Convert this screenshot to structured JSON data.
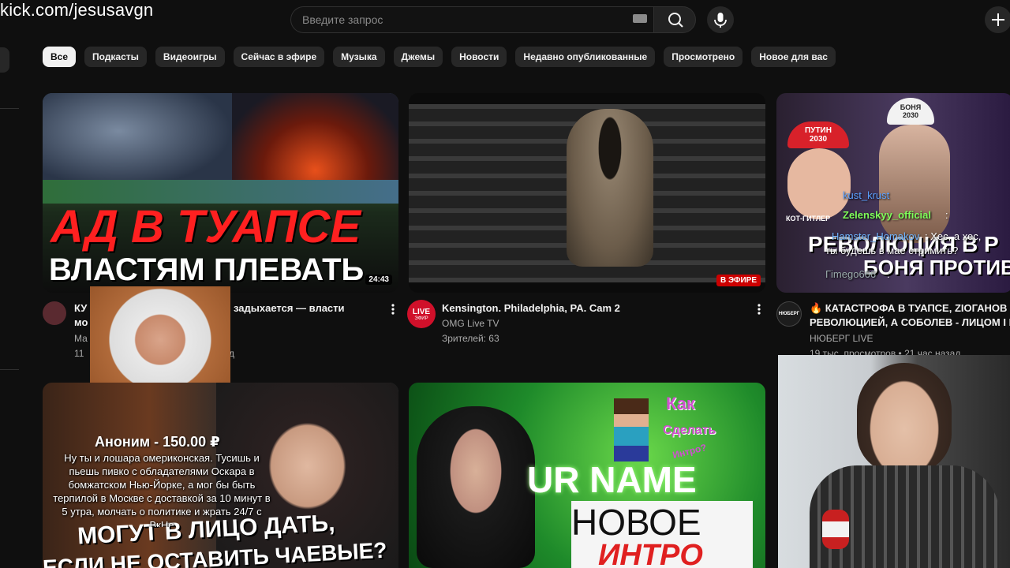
{
  "overlay": {
    "url": "kick.com/jesusavgn"
  },
  "search": {
    "placeholder": "Введите запрос"
  },
  "chips": [
    "Все",
    "Подкасты",
    "Видеоигры",
    "Сейчас в эфире",
    "Музыка",
    "Джемы",
    "Новости",
    "Недавно опубликованные",
    "Просмотрено",
    "Новое для вас"
  ],
  "videos": [
    {
      "thumb_top": "АД В ТУАПСЕ",
      "thumb_bottom": "ВЛАСТЯМ ПЛЕВАТЬ",
      "duration": "24:43",
      "title_visible_a": "КУ",
      "title_visible_b": "задыхается — власти",
      "title_visible_c": "мо",
      "channel_visible": "Ма",
      "stats_visible_a": "11",
      "stats_visible_b": "д"
    },
    {
      "title": "Kensington. Philadelphia, PA. Cam 2",
      "channel": "OMG Live TV",
      "stats": "Зрителей: 63",
      "live_badge": "В ЭФИРЕ",
      "avatar_text": "LIVE",
      "avatar_sub": "ЭФИР"
    },
    {
      "title_line1": "🔥 КАТАСТРОФА В ТУАПСЕ, ZIОГАНОВ П",
      "title_line2": "РЕВОЛЮЦИЕЙ, А СОБОЛЕВ - ЛИЦОМ І М",
      "channel": "НЮБЕРГ LIVE",
      "stats": "19 тыс. просмотров • 21 час назад",
      "avatar_text": "НЮБЕРГ",
      "thumb_text1": "РЕВОЛЮЦИЯ В Р",
      "thumb_text2": "БОНЯ ПРОТИВ Б",
      "cap1": "ПУТИН 2030",
      "cap2": "БОНЯ 2030",
      "label": "КОТ-ГИТЛЕР"
    },
    {
      "thumb_text1": "МОГУТ В ЛИЦО ДАТЬ,",
      "thumb_text2": "ЕСЛИ НЕ ОСТАВИТЬ ЧАЕВЫЕ?"
    },
    {
      "thumb_text1": "UR NAME",
      "thumb_text2": "НОВОЕ",
      "thumb_text3": "ИНТРО",
      "side1": "Как",
      "side2": "Сделать",
      "side3": "Интро?"
    }
  ],
  "stream_chat": [
    {
      "user": "kust_krust",
      "text": ""
    },
    {
      "user": "Zelenskyy_official",
      "text": ":"
    },
    {
      "user": "Hamster_Homakov",
      "text": ": Хес, а хес,"
    },
    {
      "user": "",
      "text": "ты будешь в мае стримить?"
    },
    {
      "user": "Гimego666",
      "text": ":"
    }
  ],
  "donation": {
    "header": "Аноним - 150.00 ₽",
    "message": "Ну ты и лошара омериконская. Тусишь и пьешь пивко с обладателями Оскара в бомжатском Нью-Йорке, а мог бы быть терпилой в Москве с доставкой за 10 минут в 5 утра, молчать о политике и жрать 24/7 с ВкНе"
  },
  "colors": {
    "bg": "#0f0f0f",
    "chip": "#272727",
    "accent_red": "#cc0000",
    "chat_green": "#7fff5a"
  }
}
